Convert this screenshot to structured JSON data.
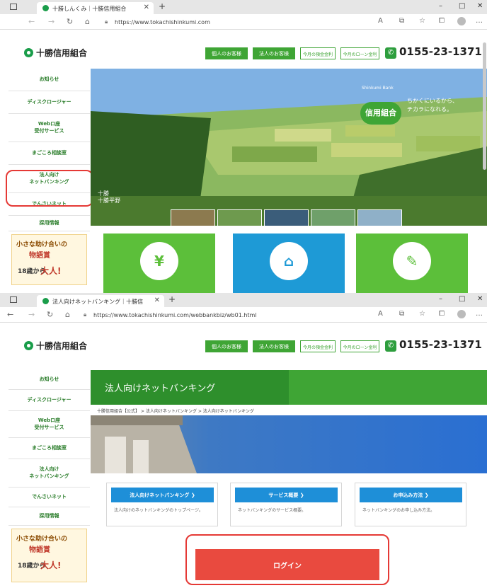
{
  "shot1": {
    "browser": {
      "tab_title": "十勝しんくみ｜十勝信用組合",
      "url": "https://www.tokachishinkumi.com"
    },
    "header": {
      "logo": "十勝信用組合",
      "btn_personal": "個人のお客様",
      "btn_corporate": "法人のお客様",
      "btn_deposit": "今月の預金金利",
      "btn_loan": "今月のローン金利",
      "phone": "0155-23-1371"
    },
    "sidebar": [
      "お知らせ",
      "ディスクロージャー",
      "Webロ座\n受付サービス",
      "まごころ相談室",
      "法人向け\nネットバンキング",
      "でんさいネット",
      "採用情報"
    ],
    "promo": {
      "line1": "小さな助け合いの",
      "line2": "物語賞",
      "line3": "18歳から",
      "line4": "大人!"
    },
    "hero": {
      "brand": "Shinkumi Bank",
      "badge": "信用組合",
      "tagline": "ちかくにいるから、\nチカラになれる。",
      "caption": "十勝\n十勝平野"
    }
  },
  "shot2": {
    "browser": {
      "tab_title": "法人向けネットバンキング｜十勝信",
      "url": "https://www.tokachishinkumi.com/webbankbiz/wb01.html"
    },
    "header": {
      "logo": "十勝信用組合",
      "btn_personal": "個人のお客様",
      "btn_corporate": "法人のお客様",
      "btn_deposit": "今月の預金金利",
      "btn_loan": "今月のローン金利",
      "phone": "0155-23-1371"
    },
    "sidebar": [
      "お知らせ",
      "ディスクロージャー",
      "Webロ座\n受付サービス",
      "まごころ相談室",
      "法人向け\nネットバンキング",
      "でんさいネット",
      "採用情報"
    ],
    "promo": {
      "line1": "小さな助け合いの",
      "line2": "物語賞",
      "line3": "18歳から",
      "line4": "大人!"
    },
    "page_title": "法人向けネットバンキング",
    "breadcrumb": "十勝信用組合【公式】 > 法人向けネットバンキング > 法人向けネットバンキング",
    "cards": [
      {
        "button": "法人向けネットバンキング ❯",
        "desc": "法人向けのネットバンキングのトップページ。"
      },
      {
        "button": "サービス概要 ❯",
        "desc": "ネットバンキングのサービス概要。"
      },
      {
        "button": "お申込み方法 ❯",
        "desc": "ネットバンキングのお申し込み方法。"
      }
    ],
    "login": "ログイン"
  },
  "colors": {
    "brand_green": "#3fa535",
    "link_blue": "#1e8fd8",
    "login_red": "#e94a3f",
    "highlight_red": "#e53935"
  }
}
